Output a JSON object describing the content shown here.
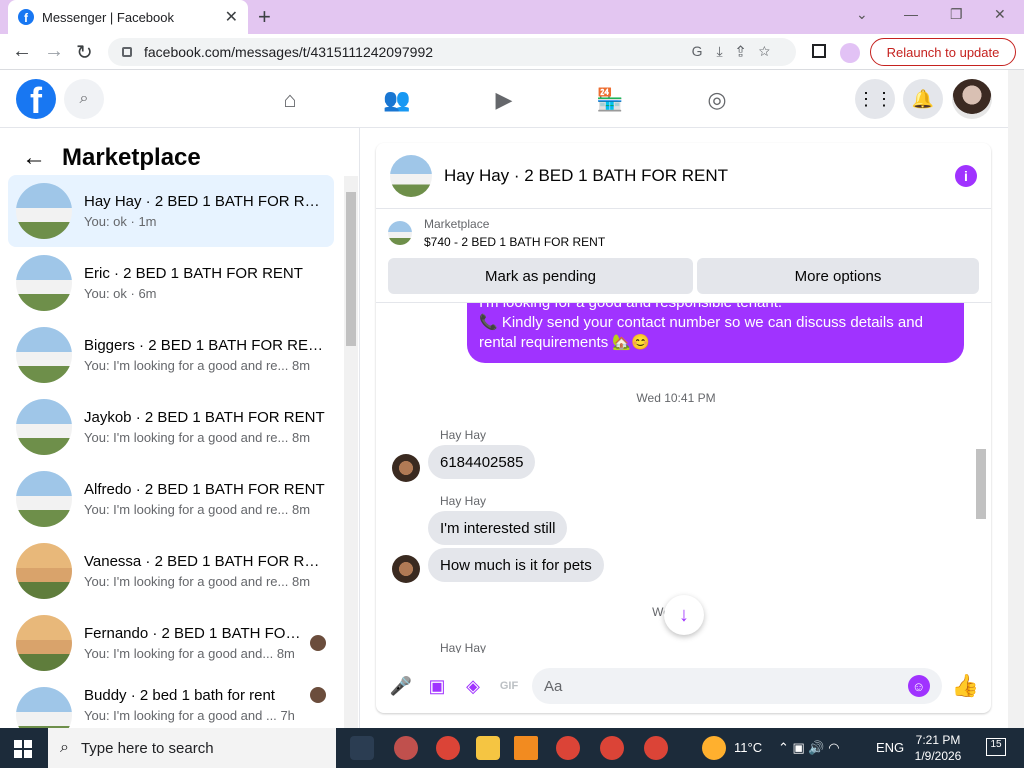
{
  "browser": {
    "tab_title": "Messenger | Facebook",
    "url": "facebook.com/messages/t/4315111242097992",
    "relaunch_label": "Relaunch to update"
  },
  "sidebar": {
    "title": "Marketplace",
    "conversations": [
      {
        "name": "Hay Hay · 2 BED 1 BATH FOR RE...",
        "preview": "You: ok · 1m",
        "time": "",
        "active": true
      },
      {
        "name": "Eric · 2 BED 1 BATH FOR RENT",
        "preview": "You: ok · 6m",
        "time": ""
      },
      {
        "name": "Biggers · 2 BED 1 BATH FOR RENT",
        "preview": "You: I'm looking for a good and re...",
        "time": "8m"
      },
      {
        "name": "Jaykob · 2 BED 1 BATH FOR RENT",
        "preview": "You: I'm looking for a good and re...",
        "time": "8m"
      },
      {
        "name": "Alfredo · 2 BED 1 BATH FOR RENT",
        "preview": "You: I'm looking for a good and re...",
        "time": "8m"
      },
      {
        "name": "Vanessa · 2 BED 1 BATH FOR RENT",
        "preview": "You: I'm looking for a good and re...",
        "time": "8m"
      },
      {
        "name": "Fernando · 2 BED 1 BATH FOR...",
        "preview": "You: I'm looking for a good and...",
        "time": "8m"
      },
      {
        "name": "Buddy · 2 bed 1 bath for rent",
        "preview": "You: I'm looking for a good and ...",
        "time": "7h"
      }
    ]
  },
  "chat": {
    "title": "Hay Hay · 2 BED 1 BATH FOR RENT",
    "marketplace_label": "Marketplace",
    "listing": "$740 - 2 BED 1 BATH FOR RENT",
    "mark_pending": "Mark as pending",
    "more_options": "More options",
    "outgoing": [
      "I'm looking for a good and responsible tenant.",
      "📞 Kindly send your contact number so we can discuss details and rental requirements 🏡😊"
    ],
    "timestamp1": "Wed 10:41 PM",
    "sender1": "Hay Hay",
    "msg1": "6184402585",
    "sender2": "Hay Hay",
    "msg2": "I'm interested still",
    "msg3": "How much is it for pets",
    "timestamp2": "Wed ...M",
    "sender3": "Hay Hay",
    "composer_placeholder": "Aa"
  },
  "taskbar": {
    "search_placeholder": "Type here to search",
    "weather": "11°C",
    "lang": "ENG",
    "time": "7:21 PM",
    "date": "1/9/2026",
    "notifications": "15"
  }
}
